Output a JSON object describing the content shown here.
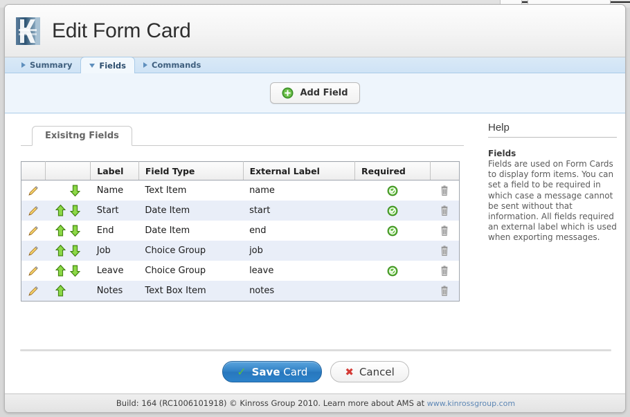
{
  "window": {
    "title": "Edit Form Card",
    "logo_icon": "kinross-k-logo"
  },
  "tabs": [
    {
      "label": "Summary",
      "icon": "triangle-right-icon",
      "active": false
    },
    {
      "label": "Fields",
      "icon": "triangle-down-icon",
      "active": true
    },
    {
      "label": "Commands",
      "icon": "triangle-right-icon",
      "active": false
    }
  ],
  "toolbar": {
    "add_field_label": "Add Field",
    "add_field_icon": "plus-circle-green-icon"
  },
  "subtab": {
    "label": "Exisitng Fields"
  },
  "table": {
    "columns": [
      "",
      "",
      "Label",
      "Field Type",
      "External Label",
      "Required",
      ""
    ],
    "icons": {
      "edit": "pencil-icon",
      "move_up": "arrow-up-green-icon",
      "move_down": "arrow-down-green-icon",
      "required": "check-circle-green-icon",
      "delete": "trash-icon"
    },
    "rows": [
      {
        "label": "Name",
        "type": "Text Item",
        "external": "name",
        "required": true,
        "up": false,
        "down": true
      },
      {
        "label": "Start",
        "type": "Date Item",
        "external": "start",
        "required": true,
        "up": true,
        "down": true
      },
      {
        "label": "End",
        "type": "Date Item",
        "external": "end",
        "required": true,
        "up": true,
        "down": true
      },
      {
        "label": "Job",
        "type": "Choice Group",
        "external": "job",
        "required": false,
        "up": true,
        "down": true
      },
      {
        "label": "Leave",
        "type": "Choice Group",
        "external": "leave",
        "required": true,
        "up": true,
        "down": true
      },
      {
        "label": "Notes",
        "type": "Text Box Item",
        "external": "notes",
        "required": false,
        "up": true,
        "down": false
      }
    ]
  },
  "help": {
    "title": "Help",
    "heading": "Fields",
    "text": "Fields are used on Form Cards to display form items. You can set a field to be required in which case a message cannot be sent without that information. All fields required an external label which is used when exporting messages."
  },
  "footer_buttons": {
    "save_lead": "Save",
    "save_rest": "Card",
    "save_icon": "check-icon",
    "cancel_label": "Cancel",
    "cancel_icon": "x-icon"
  },
  "statusbar": {
    "text": "Build: 164 (RC1006101918) © Kinross Group 2010. Learn more about AMS at",
    "link": "www.kinrossgroup.com"
  },
  "colors": {
    "accent_blue": "#2e7fc4",
    "tab_blue": "#cfe3f5",
    "row_alt": "#e9eef8",
    "green": "#5fbf3a",
    "red": "#d43b36"
  }
}
